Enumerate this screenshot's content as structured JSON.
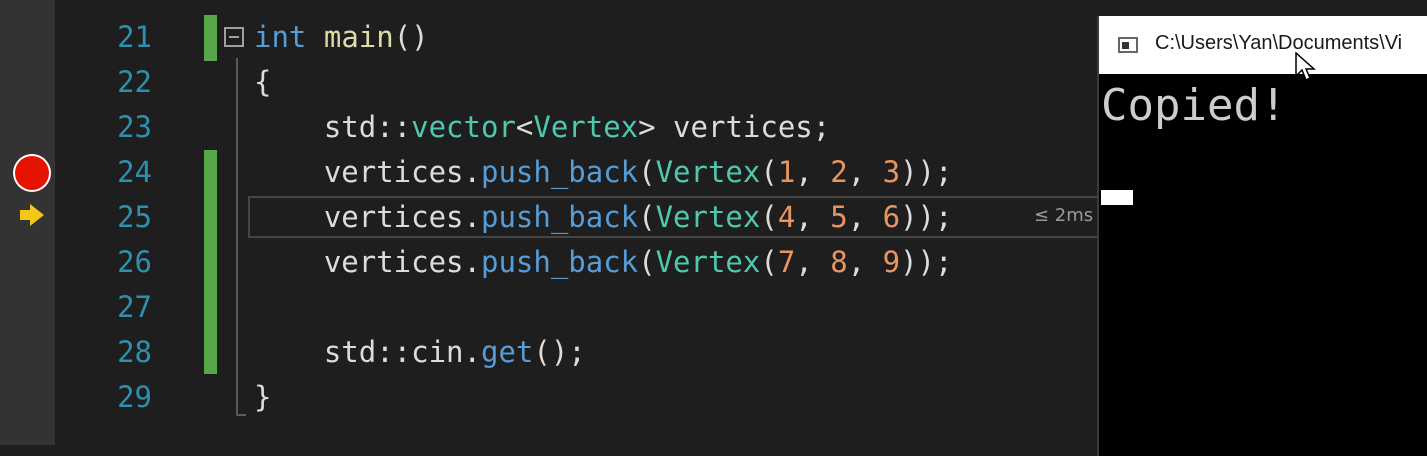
{
  "editor": {
    "lines": [
      {
        "num": "21",
        "code": [
          {
            "t": "int",
            "c": "kw"
          },
          {
            "t": " "
          },
          {
            "t": "main",
            "c": "fn"
          },
          {
            "t": "()"
          }
        ]
      },
      {
        "num": "22",
        "code": [
          {
            "t": "{"
          }
        ]
      },
      {
        "num": "23",
        "code": [
          {
            "t": "    std::"
          },
          {
            "t": "vector",
            "c": "ty"
          },
          {
            "t": "<"
          },
          {
            "t": "Vertex",
            "c": "ty"
          },
          {
            "t": "> vertices;"
          }
        ]
      },
      {
        "num": "24",
        "code": [
          {
            "t": "    vertices."
          },
          {
            "t": "push_back",
            "c": "mb"
          },
          {
            "t": "("
          },
          {
            "t": "Vertex",
            "c": "ty"
          },
          {
            "t": "("
          },
          {
            "t": "1",
            "c": "nm"
          },
          {
            "t": ", "
          },
          {
            "t": "2",
            "c": "nm"
          },
          {
            "t": ", "
          },
          {
            "t": "3",
            "c": "nm"
          },
          {
            "t": "));"
          }
        ]
      },
      {
        "num": "25",
        "code": [
          {
            "t": "    vertices."
          },
          {
            "t": "push_back",
            "c": "mb"
          },
          {
            "t": "("
          },
          {
            "t": "Vertex",
            "c": "ty"
          },
          {
            "t": "("
          },
          {
            "t": "4",
            "c": "nm"
          },
          {
            "t": ", "
          },
          {
            "t": "5",
            "c": "nm"
          },
          {
            "t": ", "
          },
          {
            "t": "6",
            "c": "nm"
          },
          {
            "t": "));"
          }
        ]
      },
      {
        "num": "26",
        "code": [
          {
            "t": "    vertices."
          },
          {
            "t": "push_back",
            "c": "mb"
          },
          {
            "t": "("
          },
          {
            "t": "Vertex",
            "c": "ty"
          },
          {
            "t": "("
          },
          {
            "t": "7",
            "c": "nm"
          },
          {
            "t": ", "
          },
          {
            "t": "8",
            "c": "nm"
          },
          {
            "t": ", "
          },
          {
            "t": "9",
            "c": "nm"
          },
          {
            "t": "));"
          }
        ]
      },
      {
        "num": "27",
        "code": []
      },
      {
        "num": "28",
        "code": [
          {
            "t": "    std::cin."
          },
          {
            "t": "get",
            "c": "mb"
          },
          {
            "t": "();"
          }
        ]
      },
      {
        "num": "29",
        "code": [
          {
            "t": "}"
          }
        ]
      }
    ],
    "breakpoint_line": "24",
    "current_line": "25",
    "perf_tip": "≤ 2ms",
    "icons": {
      "breakpoint": "breakpoint-icon",
      "execution": "next-statement-arrow-icon",
      "fold": "collapse-icon"
    }
  },
  "console": {
    "title": "C:\\Users\\Yan\\Documents\\Vi",
    "output": "Copied!",
    "icon": "console-window-icon"
  },
  "colors": {
    "background": "#1e1e1e",
    "line_number": "#2b91af",
    "keyword": "#569cd6",
    "type": "#4ec9b0",
    "number": "#e8955f",
    "change_bar": "#57a64a",
    "breakpoint": "#e51400",
    "arrow": "#f5c518"
  }
}
